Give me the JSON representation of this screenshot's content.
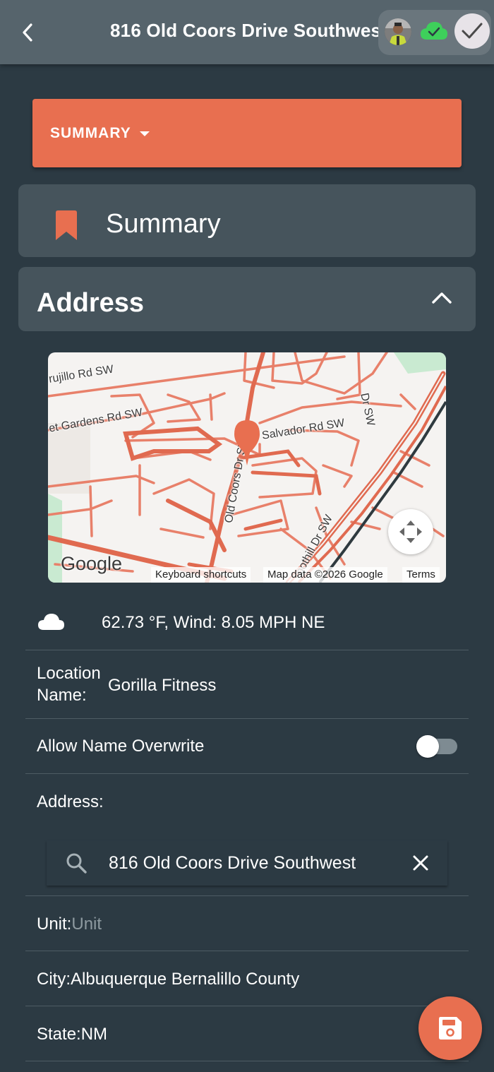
{
  "header": {
    "title": "816 Old Coors Drive Southwest",
    "back_icon": "chevron-left-icon",
    "sync_icon": "cloud-check-icon",
    "sync_color": "#3ecf5b",
    "confirm_icon": "check-icon"
  },
  "section_dropdown": {
    "label": "SUMMARY",
    "icon": "caret-down-icon",
    "color": "#e86f50"
  },
  "summary_card": {
    "title": "Summary",
    "icon": "bookmark-icon"
  },
  "address_card": {
    "title": "Address",
    "icon": "chevron-up-icon"
  },
  "map": {
    "road_labels": [
      "rujillo Rd SW",
      "et Gardens Rd SW",
      "Salvador Rd SW",
      "Old Coors Dr SW",
      "oothill Dr SW",
      "Dr SW"
    ],
    "logo": "Google",
    "shortcuts": "Keyboard shortcuts",
    "map_data": "Map data ©2026 Google",
    "terms": "Terms",
    "pin_icon": "map-pin-icon",
    "fullscreen_icon": "fullscreen-icon"
  },
  "weather": {
    "icon": "cloud-icon",
    "text": "62.73 °F, Wind: 8.05 MPH NE"
  },
  "location_name": {
    "label_line1": "Location",
    "label_line2": "Name:",
    "value": "Gorilla Fitness"
  },
  "allow_overwrite": {
    "label": "Allow Name Overwrite",
    "enabled": false
  },
  "address": {
    "label": "Address:",
    "value": "816 Old Coors Drive Southwest",
    "search_icon": "search-icon",
    "clear_icon": "close-icon"
  },
  "unit": {
    "label": "Unit:",
    "placeholder": "Unit"
  },
  "city": {
    "label": "City:",
    "value": "Albuquerque Bernalillo County"
  },
  "state": {
    "label": "State:",
    "value": "NM"
  },
  "fab": {
    "icon": "save-icon"
  }
}
